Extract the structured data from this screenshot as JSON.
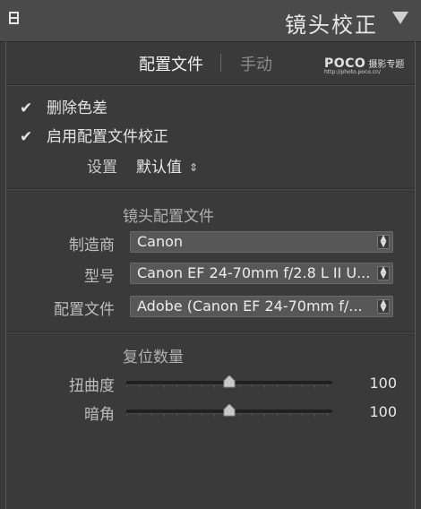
{
  "header": {
    "title": "镜头校正"
  },
  "tabs": [
    {
      "label": "配置文件"
    },
    {
      "label": "手动"
    }
  ],
  "watermark": {
    "logo": "POCO",
    "name": "摄影专题",
    "url": "http://photo.poco.cn/"
  },
  "checks": [
    {
      "label": "删除色差",
      "checked": true,
      "mark": "✔"
    },
    {
      "label": "启用配置文件校正",
      "checked": true,
      "mark": "✔"
    }
  ],
  "setup": {
    "label": "设置",
    "value": "默认值",
    "arrows": "⇕"
  },
  "profile_section": {
    "title": "镜头配置文件",
    "rows": [
      {
        "label": "制造商",
        "value": "Canon"
      },
      {
        "label": "型号",
        "value": "Canon EF 24-70mm f/2.8 L II U..."
      },
      {
        "label": "配置文件",
        "value": "Adobe (Canon EF 24-70mm f/..."
      }
    ]
  },
  "amount_section": {
    "title": "复位数量",
    "sliders": [
      {
        "label": "扭曲度",
        "value": "100",
        "level": 0.5
      },
      {
        "label": "暗角",
        "value": "100",
        "level": 0.5
      }
    ]
  }
}
